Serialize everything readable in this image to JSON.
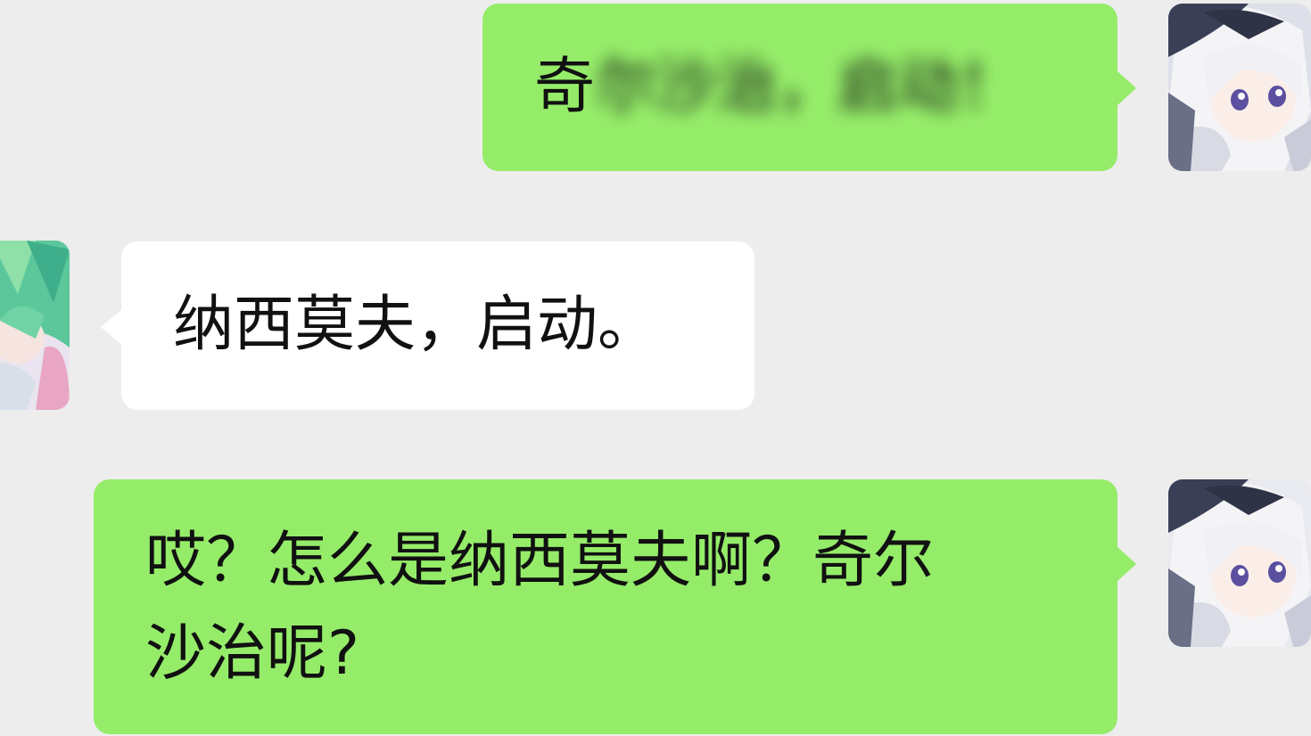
{
  "conversation": {
    "messages": [
      {
        "sender": "self",
        "visible_text": "奇",
        "redacted_text": "尔沙治，启动！",
        "avatar_icon": "white-haired-anime-avatar-icon"
      },
      {
        "sender": "other",
        "text": "纳西莫夫，启动。",
        "avatar_icon": "green-haired-anime-avatar-icon"
      },
      {
        "sender": "self",
        "line1": "哎？怎么是纳西莫夫啊？奇尔",
        "line2": "沙治呢?",
        "avatar_icon": "white-haired-anime-avatar-icon"
      }
    ]
  },
  "theme": {
    "background": "#ededed",
    "self_bubble": "#95ec69",
    "other_bubble": "#ffffff",
    "text": "#111111"
  }
}
